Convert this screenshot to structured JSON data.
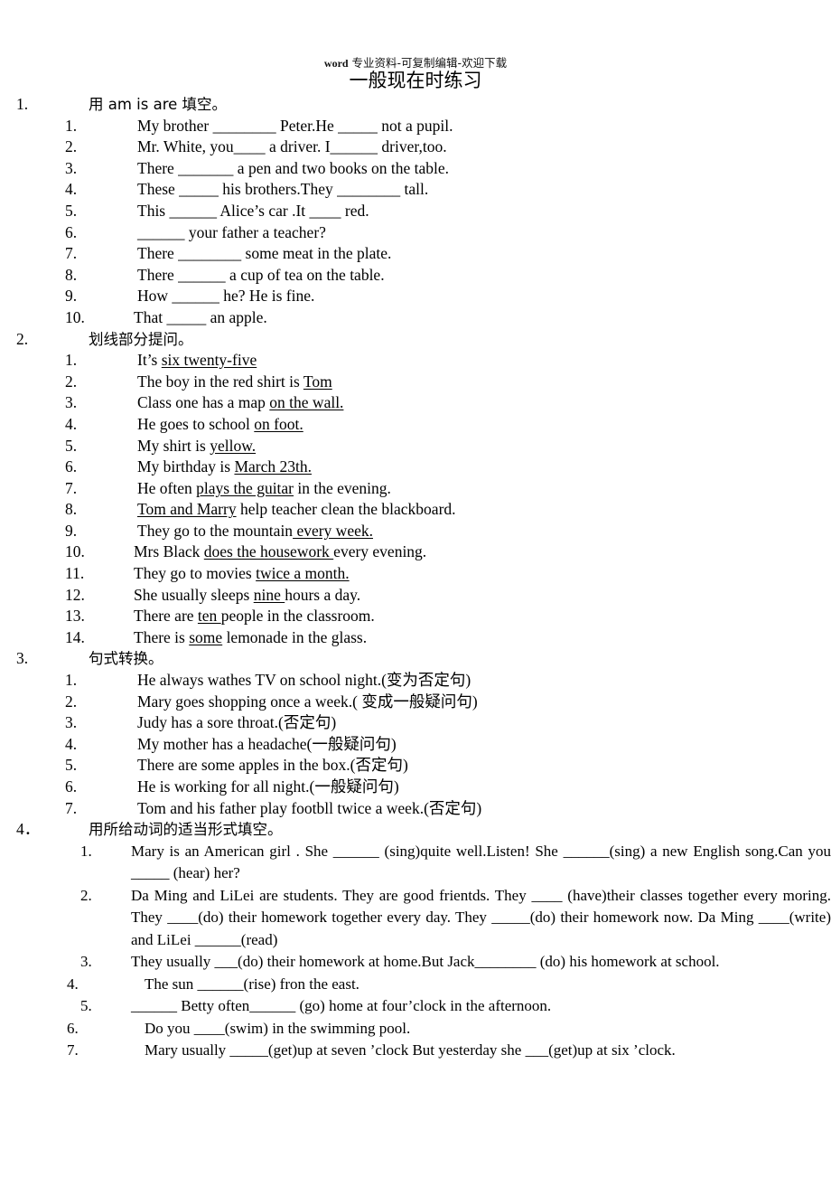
{
  "header": {
    "watermark_latin": "word",
    "watermark_cjk": " 专业资料-可复制编辑-欢迎下载",
    "title": "一般现在时练习"
  },
  "sections": [
    {
      "number": "1.",
      "heading": "用 am is are  填空。",
      "items": [
        {
          "n": "1.",
          "text": "My brother ________ Peter.He _____ not a pupil."
        },
        {
          "n": "2.",
          "text": "Mr. White, you____ a driver. I______ driver,too."
        },
        {
          "n": "3.",
          "text": "There _______ a pen and two books on the table."
        },
        {
          "n": "4.",
          "text": "These _____ his brothers.They ________ tall."
        },
        {
          "n": "5.",
          "text": "This ______ Alice’s car .It ____ red."
        },
        {
          "n": "6.",
          "text": "______ your father a teacher?"
        },
        {
          "n": "7.",
          "text": "There ________ some meat in the plate."
        },
        {
          "n": "8.",
          "text": "There ______ a cup of tea on the table."
        },
        {
          "n": "9.",
          "text": "How ______ he? He is fine."
        },
        {
          "n": "10.",
          "text": "That _____ an apple."
        }
      ]
    },
    {
      "number": "2.",
      "heading": "划线部分提问。",
      "items": [
        {
          "n": "1.",
          "pre": "It’s ",
          "mark": "six twenty-five ",
          "post": ""
        },
        {
          "n": "2.",
          "pre": "The boy in the red shirt is ",
          "mark": "Tom",
          "post": ""
        },
        {
          "n": "3.",
          "pre": "Class one has a map ",
          "mark": "on the wall.",
          "post": ""
        },
        {
          "n": "4.",
          "pre": "He goes to school ",
          "mark": "on foot.",
          "post": ""
        },
        {
          "n": "5.",
          "pre": "My shirt is ",
          "mark": "yellow.",
          "post": ""
        },
        {
          "n": "6.",
          "pre": "My birthday is ",
          "mark": "March 23th. ",
          "post": ""
        },
        {
          "n": "7.",
          "pre": "He often ",
          "mark": "plays the guitar",
          "post": " in the evening."
        },
        {
          "n": "8.",
          "pre": "",
          "mark": "Tom and Marry",
          "post": " help teacher clean the blackboard."
        },
        {
          "n": "9.",
          "pre": "They go to the mountain",
          "mark": " every week.",
          "post": ""
        },
        {
          "n": "10.",
          "pre": "Mrs Black ",
          "mark": "does the housework ",
          "post": "every evening."
        },
        {
          "n": "11.",
          "pre": "They go to movies ",
          "mark": "twice a month.",
          "post": ""
        },
        {
          "n": "12.",
          "pre": "She usually sleeps ",
          "mark": "nine ",
          "post": "hours a day."
        },
        {
          "n": "13.",
          "pre": "There are ",
          "mark": "ten ",
          "post": "people in the classroom."
        },
        {
          "n": "14.",
          "pre": "There is ",
          "mark": "some",
          "post": " lemonade in the glass."
        }
      ]
    },
    {
      "number": "3.",
      "heading": "句式转换。",
      "items": [
        {
          "n": "1.",
          "text": "He always wathes TV on school night.(变为否定句)"
        },
        {
          "n": "2.",
          "text": "Mary goes shopping once a week.(  变成一般疑问句)"
        },
        {
          "n": "3.",
          "text": "Judy has a sore throat.(否定句)"
        },
        {
          "n": "4.",
          "text": "My mother has a headache(一般疑问句)"
        },
        {
          "n": "5.",
          "text": "There are some apples in the box.(否定句)"
        },
        {
          "n": "6.",
          "text": "He is working for all night.(一般疑问句)"
        },
        {
          "n": "7.",
          "text": "Tom and his father play footbll twice a week.(否定句)"
        }
      ]
    },
    {
      "number": "4．",
      "heading": "用所给动词的适当形式填空。",
      "items": [
        {
          "n": "1.",
          "text": "Mary is an American girl . She ______ (sing)quite well.Listen! She ______(sing) a new English song.Can you _____ (hear) her?"
        },
        {
          "n": "2.",
          "text": "Da Ming and LiLei are students. They are good frientds. They ____ (have)their classes together every moring. They ____(do) their homework together every day. They _____(do) their homework now. Da Ming ____(write) and LiLei ______(read)"
        },
        {
          "n": "3.",
          "text": "They usually ___(do) their homework at home.But Jack________ (do) his homework at school."
        },
        {
          "n": "4.",
          "text": "The sun ______(rise) fron the east."
        },
        {
          "n": "5.",
          "text": "______ Betty often______ (go) home at four’clock in the afternoon."
        },
        {
          "n": "6.",
          "text": "Do you ____(swim) in the swimming pool."
        },
        {
          "n": "7.",
          "text": "Mary usually _____(get)up at seven ’clock But yesterday she ___(get)up at six ’clock."
        }
      ]
    }
  ]
}
